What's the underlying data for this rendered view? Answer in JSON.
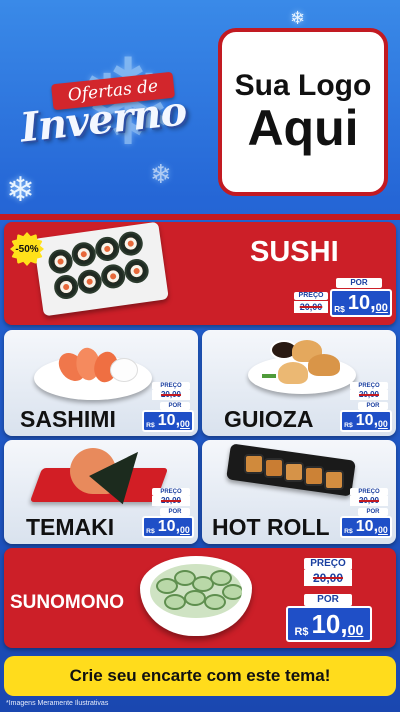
{
  "header": {
    "promo_ribbon": "Ofertas de",
    "promo_title": "Inverno",
    "logo_line1": "Sua Logo",
    "logo_line2": "Aqui"
  },
  "featured": {
    "title": "SUSHI",
    "discount_badge": "-50%",
    "price_label": "PREÇO",
    "old_price": "20,00",
    "por_label": "POR",
    "currency": "R$",
    "new_price_int": "10",
    "new_price_cents": "00"
  },
  "items": [
    {
      "title": "SASHIMI",
      "price_label": "PREÇO",
      "old_price": "20,00",
      "por_label": "POR",
      "currency": "R$",
      "new_price_int": "10",
      "new_price_cents": "00"
    },
    {
      "title": "GUIOZA",
      "price_label": "PREÇO",
      "old_price": "20,00",
      "por_label": "POR",
      "currency": "R$",
      "new_price_int": "10",
      "new_price_cents": "00"
    },
    {
      "title": "TEMAKI",
      "price_label": "PREÇO",
      "old_price": "20,00",
      "por_label": "POR",
      "currency": "R$",
      "new_price_int": "10",
      "new_price_cents": "00"
    },
    {
      "title": "HOT ROLL",
      "price_label": "PREÇO",
      "old_price": "20,00",
      "por_label": "POR",
      "currency": "R$",
      "new_price_int": "10",
      "new_price_cents": "00"
    }
  ],
  "sunomono": {
    "title": "SUNOMONO",
    "price_label": "PREÇO",
    "old_price": "20,00",
    "por_label": "POR",
    "currency": "R$",
    "new_price_int": "10",
    "new_price_cents": "00"
  },
  "footer": {
    "cta": "Crie seu encarte com este tema!",
    "disclaimer": "*Imagens Meramente Ilustrativas"
  },
  "colors": {
    "brand_red": "#cc1f28",
    "brand_blue": "#1f4fc7",
    "cta_yellow": "#ffdc1c"
  }
}
